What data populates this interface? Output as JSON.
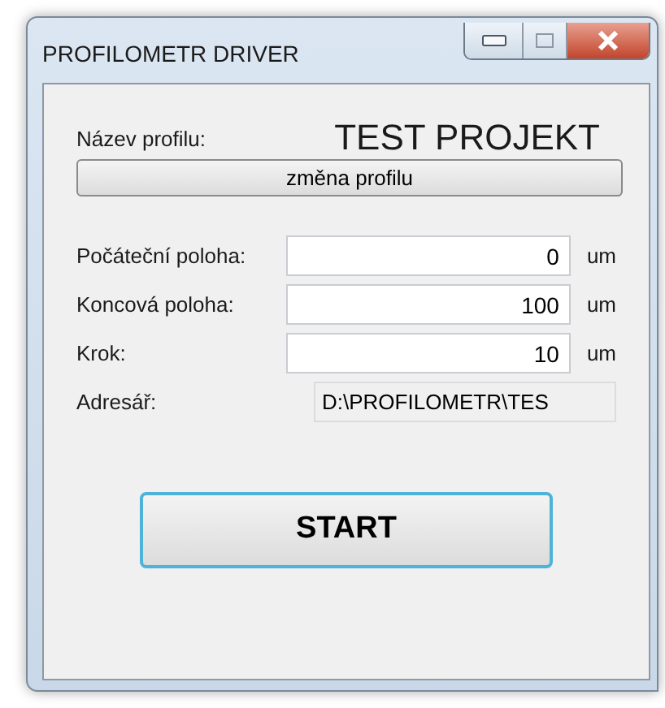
{
  "window": {
    "title": "PROFILOMETR DRIVER"
  },
  "profile": {
    "label": "Název profilu:",
    "name": "TEST PROJEKT",
    "button": "změna profilu"
  },
  "fields": [
    {
      "kind": "number",
      "label": "Počáteční poloha:",
      "value": "0",
      "unit": "um"
    },
    {
      "kind": "number",
      "label": "Koncová poloha:",
      "value": "100",
      "unit": "um"
    },
    {
      "kind": "number",
      "label": "Krok:",
      "value": "10",
      "unit": "um"
    },
    {
      "kind": "path",
      "label": "Adresář:",
      "value": "D:\\PROFILOMETR\\TES"
    }
  ],
  "start_button": "START"
}
